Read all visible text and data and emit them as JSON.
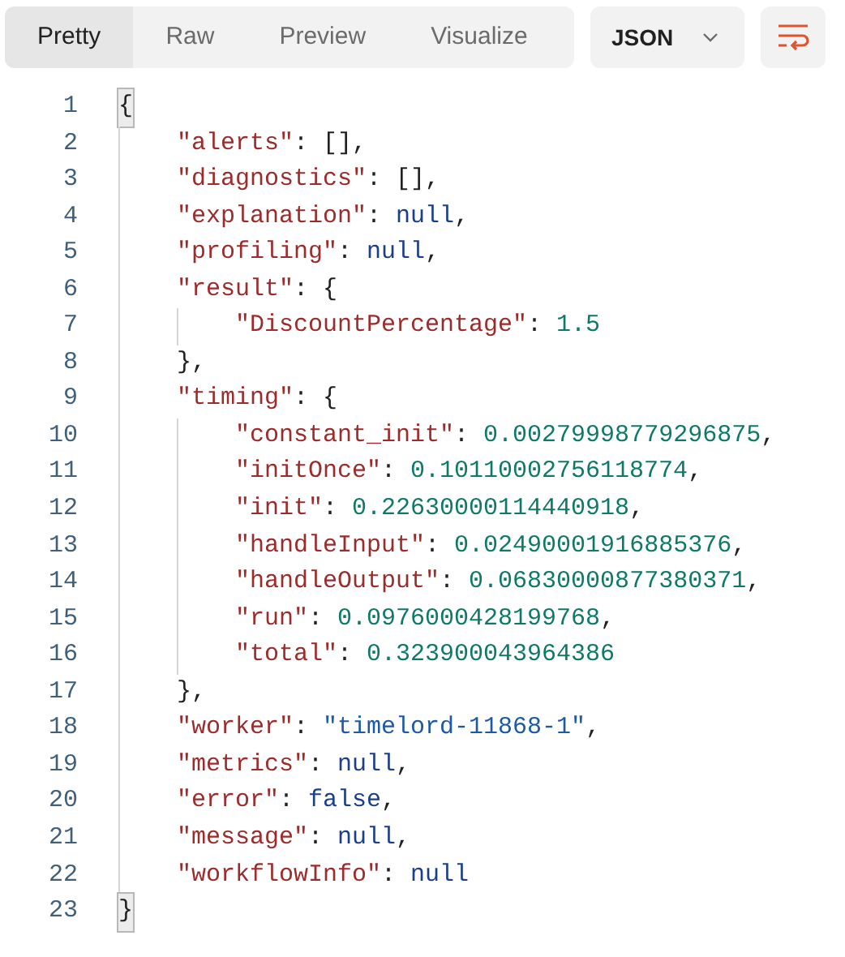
{
  "tabs": [
    {
      "label": "Pretty",
      "selected": true
    },
    {
      "label": "Raw",
      "selected": false
    },
    {
      "label": "Preview",
      "selected": false
    },
    {
      "label": "Visualize",
      "selected": false
    }
  ],
  "format_dropdown": {
    "value": "JSON"
  },
  "wrap_button": {
    "on": true
  },
  "code_lines": [
    {
      "number": "1",
      "tokens": [
        {
          "kind": "brace_match",
          "text": "{"
        }
      ],
      "children": [
        {
          "number": "2",
          "tokens": [
            {
              "kind": "key",
              "text": "\"alerts\""
            },
            {
              "kind": "punct",
              "text": ": [],"
            }
          ]
        },
        {
          "number": "3",
          "tokens": [
            {
              "kind": "key",
              "text": "\"diagnostics\""
            },
            {
              "kind": "punct",
              "text": ": [],"
            }
          ]
        },
        {
          "number": "4",
          "tokens": [
            {
              "kind": "key",
              "text": "\"explanation\""
            },
            {
              "kind": "punct",
              "text": ": "
            },
            {
              "kind": "keyword",
              "text": "null"
            },
            {
              "kind": "punct",
              "text": ","
            }
          ]
        },
        {
          "number": "5",
          "tokens": [
            {
              "kind": "key",
              "text": "\"profiling\""
            },
            {
              "kind": "punct",
              "text": ": "
            },
            {
              "kind": "keyword",
              "text": "null"
            },
            {
              "kind": "punct",
              "text": ","
            }
          ]
        },
        {
          "number": "6",
          "tokens": [
            {
              "kind": "key",
              "text": "\"result\""
            },
            {
              "kind": "punct",
              "text": ": {"
            }
          ],
          "children": [
            {
              "number": "7",
              "tokens": [
                {
                  "kind": "key",
                  "text": "\"DiscountPercentage\""
                },
                {
                  "kind": "punct",
                  "text": ": "
                },
                {
                  "kind": "number",
                  "text": "1.5"
                }
              ]
            }
          ]
        },
        {
          "number": "8",
          "tokens": [
            {
              "kind": "punct",
              "text": "},"
            }
          ]
        },
        {
          "number": "9",
          "tokens": [
            {
              "kind": "key",
              "text": "\"timing\""
            },
            {
              "kind": "punct",
              "text": ": {"
            }
          ],
          "children": [
            {
              "number": "10",
              "tokens": [
                {
                  "kind": "key",
                  "text": "\"constant_init\""
                },
                {
                  "kind": "punct",
                  "text": ": "
                },
                {
                  "kind": "number",
                  "text": "0.00279998779296875"
                },
                {
                  "kind": "punct",
                  "text": ","
                }
              ]
            },
            {
              "number": "11",
              "tokens": [
                {
                  "kind": "key",
                  "text": "\"initOnce\""
                },
                {
                  "kind": "punct",
                  "text": ": "
                },
                {
                  "kind": "number",
                  "text": "0.10110002756118774"
                },
                {
                  "kind": "punct",
                  "text": ","
                }
              ]
            },
            {
              "number": "12",
              "tokens": [
                {
                  "kind": "key",
                  "text": "\"init\""
                },
                {
                  "kind": "punct",
                  "text": ": "
                },
                {
                  "kind": "number",
                  "text": "0.22630000114440918"
                },
                {
                  "kind": "punct",
                  "text": ","
                }
              ]
            },
            {
              "number": "13",
              "tokens": [
                {
                  "kind": "key",
                  "text": "\"handleInput\""
                },
                {
                  "kind": "punct",
                  "text": ": "
                },
                {
                  "kind": "number",
                  "text": "0.02490001916885376"
                },
                {
                  "kind": "punct",
                  "text": ","
                }
              ]
            },
            {
              "number": "14",
              "tokens": [
                {
                  "kind": "key",
                  "text": "\"handleOutput\""
                },
                {
                  "kind": "punct",
                  "text": ": "
                },
                {
                  "kind": "number",
                  "text": "0.06830000877380371"
                },
                {
                  "kind": "punct",
                  "text": ","
                }
              ]
            },
            {
              "number": "15",
              "tokens": [
                {
                  "kind": "key",
                  "text": "\"run\""
                },
                {
                  "kind": "punct",
                  "text": ": "
                },
                {
                  "kind": "number",
                  "text": "0.0976000428199768"
                },
                {
                  "kind": "punct",
                  "text": ","
                }
              ]
            },
            {
              "number": "16",
              "tokens": [
                {
                  "kind": "key",
                  "text": "\"total\""
                },
                {
                  "kind": "punct",
                  "text": ": "
                },
                {
                  "kind": "number",
                  "text": "0.323900043964386"
                }
              ]
            }
          ]
        },
        {
          "number": "17",
          "tokens": [
            {
              "kind": "punct",
              "text": "},"
            }
          ]
        },
        {
          "number": "18",
          "tokens": [
            {
              "kind": "key",
              "text": "\"worker\""
            },
            {
              "kind": "punct",
              "text": ": "
            },
            {
              "kind": "string",
              "text": "\"timelord-11868-1\""
            },
            {
              "kind": "punct",
              "text": ","
            }
          ]
        },
        {
          "number": "19",
          "tokens": [
            {
              "kind": "key",
              "text": "\"metrics\""
            },
            {
              "kind": "punct",
              "text": ": "
            },
            {
              "kind": "keyword",
              "text": "null"
            },
            {
              "kind": "punct",
              "text": ","
            }
          ]
        },
        {
          "number": "20",
          "tokens": [
            {
              "kind": "key",
              "text": "\"error\""
            },
            {
              "kind": "punct",
              "text": ": "
            },
            {
              "kind": "keyword",
              "text": "false"
            },
            {
              "kind": "punct",
              "text": ","
            }
          ]
        },
        {
          "number": "21",
          "tokens": [
            {
              "kind": "key",
              "text": "\"message\""
            },
            {
              "kind": "punct",
              "text": ": "
            },
            {
              "kind": "keyword",
              "text": "null"
            },
            {
              "kind": "punct",
              "text": ","
            }
          ]
        },
        {
          "number": "22",
          "tokens": [
            {
              "kind": "key",
              "text": "\"workflowInfo\""
            },
            {
              "kind": "punct",
              "text": ": "
            },
            {
              "kind": "keyword",
              "text": "null"
            }
          ]
        }
      ]
    },
    {
      "number": "23",
      "tokens": [
        {
          "kind": "brace_match",
          "text": "}"
        }
      ]
    }
  ]
}
